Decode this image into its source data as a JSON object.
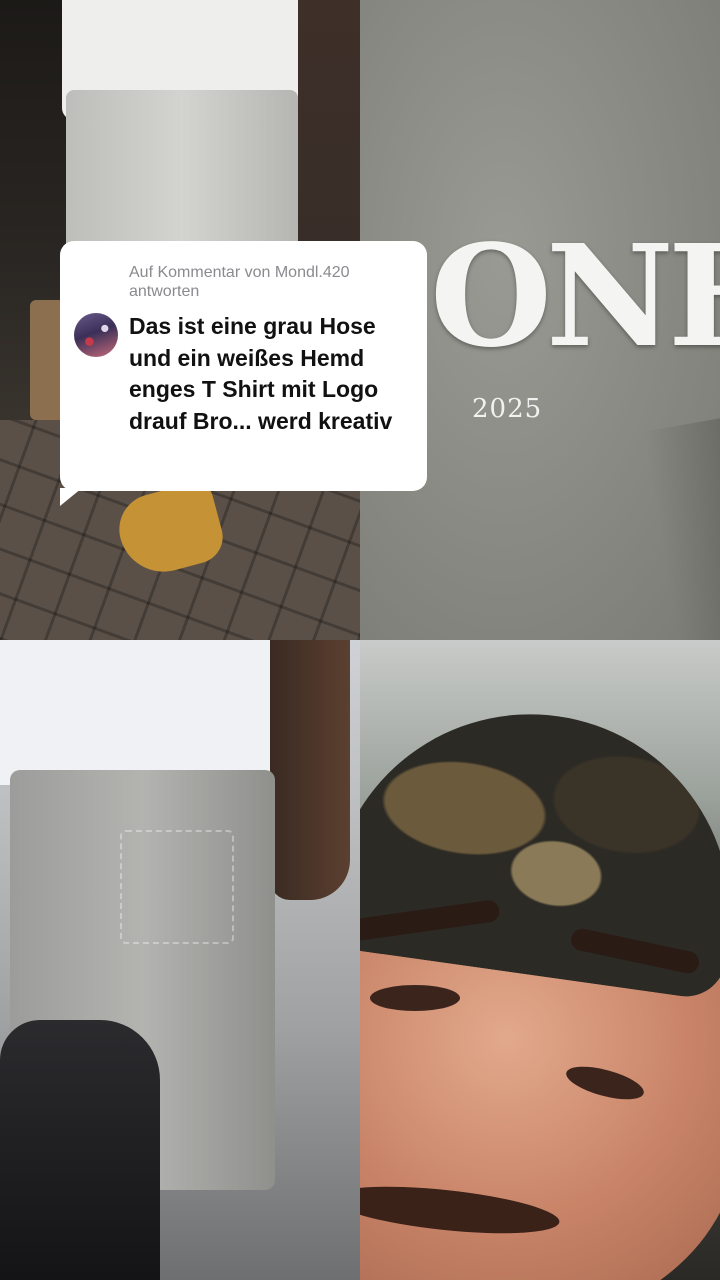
{
  "reply_card": {
    "header": "Auf Kommentar von Mondl.420 antworten",
    "comment": "Das ist eine grau Hose und ein weißes Hemd enges T Shirt mit Logo drauf Bro... werd kreativ"
  },
  "embroidery": {
    "logo_text": "ONH",
    "year": "2025"
  },
  "colors": {
    "card_background": "#ffffff",
    "header_text": "#8a8a8f",
    "comment_text": "#111111"
  }
}
